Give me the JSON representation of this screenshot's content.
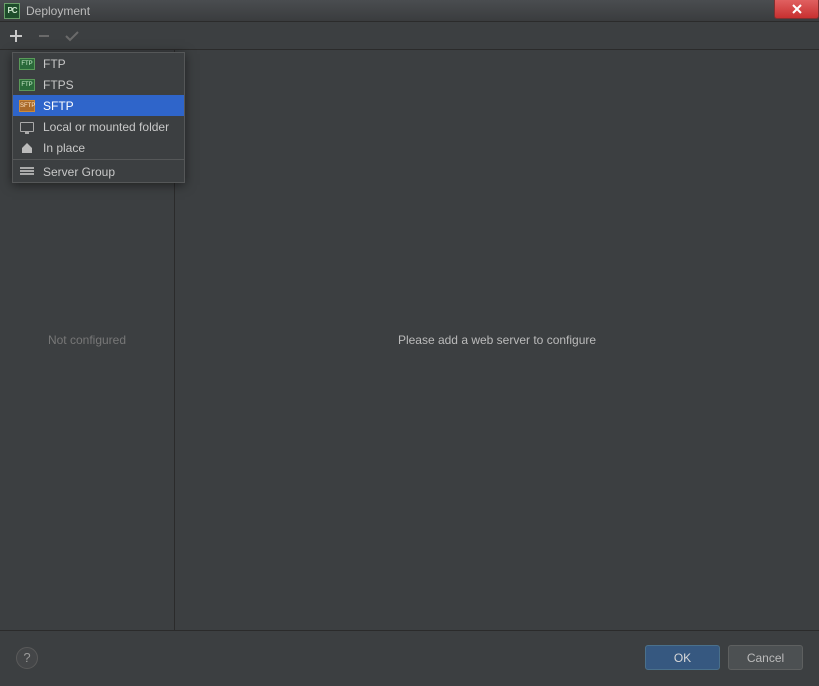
{
  "title": "Deployment",
  "app_icon_label": "PC",
  "popup": {
    "items": [
      {
        "label": "FTP",
        "icon": "ftp",
        "selected": false
      },
      {
        "label": "FTPS",
        "icon": "ftp",
        "selected": false
      },
      {
        "label": "SFTP",
        "icon": "sftp",
        "selected": true
      },
      {
        "label": "Local or mounted folder",
        "icon": "monitor",
        "selected": false
      },
      {
        "label": "In place",
        "icon": "home",
        "selected": false
      },
      {
        "label": "Server Group",
        "icon": "group",
        "selected": false,
        "sepBefore": true
      }
    ]
  },
  "sidebar": {
    "empty_text": "Not configured"
  },
  "main": {
    "empty_text": "Please add a web server to configure"
  },
  "footer": {
    "help": "?",
    "ok": "OK",
    "cancel": "Cancel"
  }
}
